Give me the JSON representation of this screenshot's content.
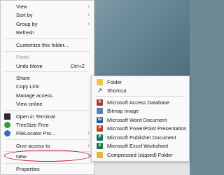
{
  "context_menu": {
    "items": [
      {
        "label": "View",
        "arrow": "›"
      },
      {
        "label": "Sort by",
        "arrow": "›"
      },
      {
        "label": "Group by",
        "arrow": "›"
      },
      {
        "label": "Refresh"
      },
      {
        "label": "Customize this folder..."
      },
      {
        "label": "Paste"
      },
      {
        "label": "Undo Move",
        "shortcut": "Ctrl+Z"
      },
      {
        "label": "Share"
      },
      {
        "label": "Copy Link"
      },
      {
        "label": "Manage access"
      },
      {
        "label": "View online"
      },
      {
        "label": "Open in Terminal"
      },
      {
        "label": "TreeSize Free"
      },
      {
        "label": "FileLocator Pro...",
        "arrow": "›"
      },
      {
        "label": "Give access to",
        "arrow": "›"
      },
      {
        "label": "New",
        "arrow": "›"
      },
      {
        "label": "Properties"
      }
    ]
  },
  "new_submenu": {
    "items": [
      {
        "label": "Folder"
      },
      {
        "label": "Shortcut"
      },
      {
        "label": "Microsoft Access Database"
      },
      {
        "label": "Bitmap image"
      },
      {
        "label": "Microsoft Word Document"
      },
      {
        "label": "Microsoft PowerPoint Presentation"
      },
      {
        "label": "Microsoft Publisher Document"
      },
      {
        "label": "Microsoft Excel Worksheet"
      },
      {
        "label": "Compressed (zipped) Folder"
      }
    ]
  },
  "colors": {
    "highlight_oval": "#c0182a",
    "background": "#6d8a96"
  }
}
